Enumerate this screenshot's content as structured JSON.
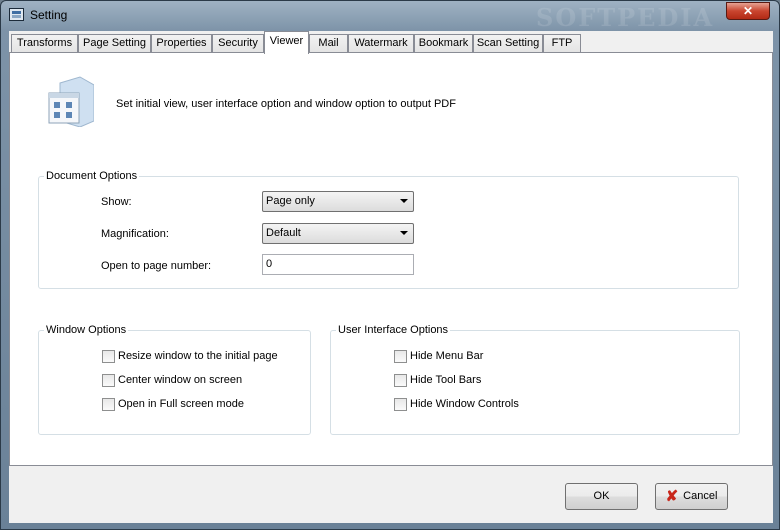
{
  "window": {
    "title": "Setting",
    "close_glyph": "✕",
    "watermark": "SOFTPEDIA"
  },
  "tabs": [
    {
      "label": "Transforms"
    },
    {
      "label": "Page Setting"
    },
    {
      "label": "Properties"
    },
    {
      "label": "Security"
    },
    {
      "label": "Viewer",
      "active": true
    },
    {
      "label": "Mail"
    },
    {
      "label": "Watermark"
    },
    {
      "label": "Bookmark"
    },
    {
      "label": "Scan Setting"
    },
    {
      "label": "FTP"
    }
  ],
  "header": {
    "description": "Set initial view, user interface option and window option to output PDF",
    "icon": "viewer-settings-icon"
  },
  "document_options": {
    "title": "Document Options",
    "show_label": "Show:",
    "show_value": "Page only",
    "magnification_label": "Magnification:",
    "magnification_value": "Default",
    "open_page_label": "Open to page number:",
    "open_page_value": "0"
  },
  "window_options": {
    "title": "Window Options",
    "items": [
      {
        "label": "Resize window to the initial page",
        "checked": false
      },
      {
        "label": "Center window on screen",
        "checked": false
      },
      {
        "label": "Open in Full screen mode",
        "checked": false
      }
    ]
  },
  "ui_options": {
    "title": "User Interface Options",
    "items": [
      {
        "label": "Hide Menu Bar",
        "checked": false
      },
      {
        "label": "Hide Tool Bars",
        "checked": false
      },
      {
        "label": "Hide Window Controls",
        "checked": false
      }
    ]
  },
  "buttons": {
    "ok": "OK",
    "cancel": "Cancel",
    "cancel_glyph": "✘"
  },
  "colors": {
    "title_bar": "#7d93a8",
    "close_button": "#c9452f",
    "cancel_icon": "#c8261a"
  }
}
